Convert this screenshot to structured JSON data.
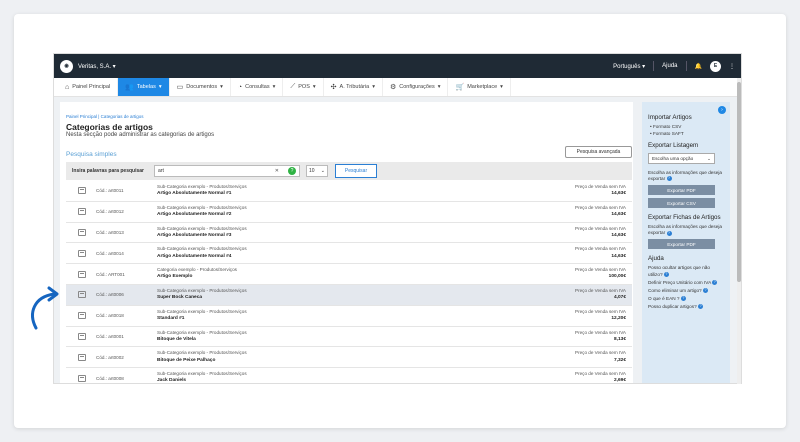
{
  "topbar": {
    "company": "Veritas, S.A.",
    "language": "Português",
    "help": "Ajuda",
    "avatar": "E"
  },
  "menu": [
    {
      "label": "Painel Principal",
      "icon": "home-icon"
    },
    {
      "label": "Tabelas",
      "icon": "users-icon"
    },
    {
      "label": "Documentos",
      "icon": "document-icon"
    },
    {
      "label": "Consultas",
      "icon": "chart-icon"
    },
    {
      "label": "POS",
      "icon": "pos-icon"
    },
    {
      "label": "A. Tributária",
      "icon": "tax-icon"
    },
    {
      "label": "Configurações",
      "icon": "gear-icon"
    },
    {
      "label": "Marketplace",
      "icon": "cart-icon"
    }
  ],
  "page": {
    "breadcrumb": "Painel Principal  |  Categorias de artigos",
    "title": "Categorias de artigos",
    "subtitle": "Nesta secção pode administrar as categorias de artigos",
    "advanced": "Pesquisa avançada",
    "simple": "Pesquisa simples"
  },
  "search": {
    "label": "Insira palavras para pesquisar",
    "value": "art",
    "per_page": "10",
    "button": "Pesquisar"
  },
  "rows": [
    {
      "code": "Cód.: art0011",
      "category": "Sub-Categoria exemplo - Produtos/Serviços",
      "name": "Artigo Absolutamente Normal #1",
      "price_label": "Preço de Venda sem IVA",
      "price": "14,63€"
    },
    {
      "code": "Cód.: art0012",
      "category": "Sub-Categoria exemplo - Produtos/Serviços",
      "name": "Artigo Absolutamente Normal #2",
      "price_label": "Preço de Venda sem IVA",
      "price": "14,63€"
    },
    {
      "code": "Cód.: art0013",
      "category": "Sub-Categoria exemplo - Produtos/Serviços",
      "name": "Artigo Absolutamente Normal #3",
      "price_label": "Preço de Venda sem IVA",
      "price": "14,63€"
    },
    {
      "code": "Cód.: art0014",
      "category": "Sub-Categoria exemplo - Produtos/Serviços",
      "name": "Artigo Absolutamente Normal #4",
      "price_label": "Preço de Venda sem IVA",
      "price": "14,63€"
    },
    {
      "code": "Cód.: ART001",
      "category": "Categoria exemplo - Produtos/Serviços",
      "name": "Artigo Exemplo",
      "price_label": "Preço de Venda sem IVA",
      "price": "100,00€"
    },
    {
      "code": "Cód.: art0006",
      "category": "Sub-Categoria exemplo - Produtos/Serviços",
      "name": "Super Bock Caneca",
      "price_label": "Preço de Venda sem IVA",
      "price": "4,07€"
    },
    {
      "code": "Cód.: art0018",
      "category": "Sub-Categoria exemplo - Produtos/Serviços",
      "name": "Standard #1",
      "price_label": "Preço de Venda sem IVA",
      "price": "12,20€"
    },
    {
      "code": "Cód.: art0001",
      "category": "Sub-Categoria exemplo - Produtos/Serviços",
      "name": "Bitoque de Vitela",
      "price_label": "Preço de Venda sem IVA",
      "price": "8,13€"
    },
    {
      "code": "Cód.: art0002",
      "category": "Sub-Categoria exemplo - Produtos/Serviços",
      "name": "Bitoque de Peixe Palhaço",
      "price_label": "Preço de Venda sem IVA",
      "price": "7,32€"
    },
    {
      "code": "Cód.: art0008",
      "category": "Sub-Categoria exemplo - Produtos/Serviços",
      "name": "Jack Daniels",
      "price_label": "Preço de Venda sem IVA",
      "price": "2,69€"
    }
  ],
  "sidebar": {
    "import_title": "Importar Artigos",
    "import_csv": "• Formato CSV",
    "import_saft": "• Formato SAFT",
    "export_title": "Exportar Listagem",
    "choose": "Escolha uma opção",
    "choose_note": "Escolha as informações que deseja exportar",
    "export_pdf": "Exportar PDF",
    "export_csv": "Exportar CSV",
    "export_sheets_title": "Exportar Fichas de Artigos",
    "sheets_note": "Escolha as informações que deseja exportar",
    "export_pdf2": "Exportar PDF",
    "help_title": "Ajuda",
    "help1": "Posso ocultar artigos que não utilizo?",
    "help2": "Definir Preço Unitário com IVA",
    "help3": "Como eliminar um artigo?",
    "help4": "O que é EAN ?",
    "help5": "Posso duplicar artigos?"
  }
}
